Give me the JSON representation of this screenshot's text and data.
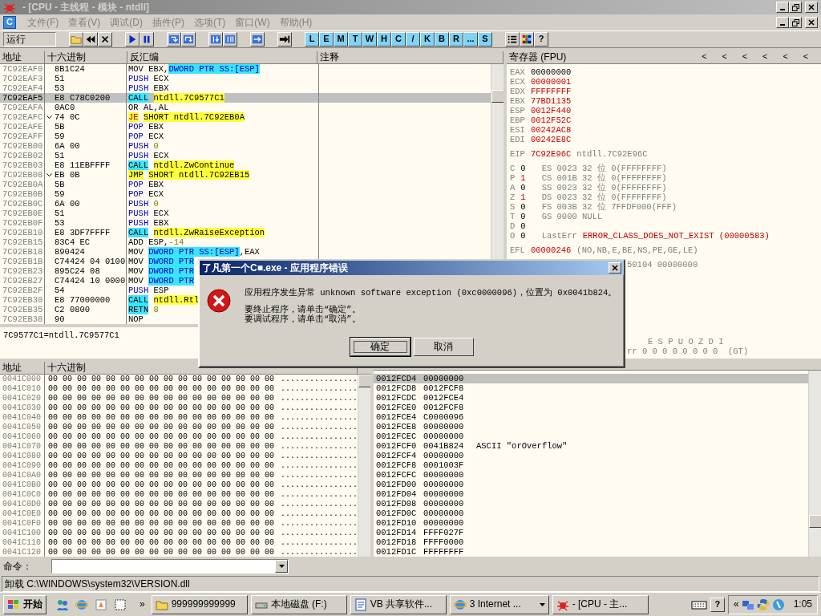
{
  "title_bar": {
    "title": "- [CPU - 主线程 - 模块 - ntdll]"
  },
  "menu_bar": {
    "app_letter": "C",
    "menus": [
      "文件(F)",
      "查看(V)",
      "调试(D)",
      "插件(P)",
      "选项(T)",
      "窗口(W)",
      "帮助(H)"
    ]
  },
  "toolbar": {
    "status": "运行",
    "groups": [
      [
        {
          "kind": "folder"
        },
        {
          "kind": "rewind"
        },
        {
          "kind": "close"
        }
      ],
      [
        {
          "kind": "play"
        },
        {
          "kind": "pause"
        }
      ],
      [
        {
          "kind": "stepin"
        },
        {
          "kind": "stepover"
        }
      ],
      [
        {
          "kind": "tracein"
        },
        {
          "kind": "traceover"
        }
      ],
      [
        {
          "kind": "return"
        }
      ],
      [
        {
          "kind": "goto"
        }
      ],
      [
        {
          "kind": "letter",
          "label": "L"
        },
        {
          "kind": "letter",
          "label": "E"
        },
        {
          "kind": "letter",
          "label": "M"
        },
        {
          "kind": "letter",
          "label": "T"
        },
        {
          "kind": "letter",
          "label": "W"
        },
        {
          "kind": "letter",
          "label": "H"
        },
        {
          "kind": "letter",
          "label": "C"
        },
        {
          "kind": "letter",
          "label": "/"
        },
        {
          "kind": "letter",
          "label": "K"
        },
        {
          "kind": "letter",
          "label": "B"
        },
        {
          "kind": "letter",
          "label": "R"
        },
        {
          "kind": "letter",
          "label": "..."
        },
        {
          "kind": "letter",
          "label": "S"
        }
      ],
      [
        {
          "kind": "list"
        },
        {
          "kind": "palette"
        },
        {
          "kind": "text",
          "label": "?"
        }
      ]
    ]
  },
  "disassembly": {
    "columns": [
      "地址",
      "十六进制",
      "反汇编",
      "注释"
    ],
    "rows": [
      {
        "addr": "7C92EAF0",
        "hex": "8B1C24",
        "jump": false,
        "selected": false,
        "asm": [
          {
            "t": "MOV",
            "kind": "mn"
          },
          {
            "t": "EBX,",
            "kind": "op"
          },
          {
            "t": "DWORD PTR SS:[ESP]",
            "kind": "mem"
          }
        ]
      },
      {
        "addr": "7C92EAF3",
        "hex": "51",
        "jump": false,
        "selected": false,
        "asm": [
          {
            "t": "PUSH",
            "kind": "stk"
          },
          {
            "t": "ECX",
            "kind": "op"
          }
        ]
      },
      {
        "addr": "7C92EAF4",
        "hex": "53",
        "jump": false,
        "selected": false,
        "asm": [
          {
            "t": "PUSH",
            "kind": "stk"
          },
          {
            "t": "EBX",
            "kind": "op"
          }
        ]
      },
      {
        "addr": "7C92EAF5",
        "hex": "E8 C78C0200",
        "jump": false,
        "selected": true,
        "asm": [
          {
            "t": "CALL",
            "kind": "call"
          },
          {
            "t": "ntdll.7C9577C1",
            "kind": "tgt"
          }
        ]
      },
      {
        "addr": "7C92EAFA",
        "hex": "0AC0",
        "jump": false,
        "selected": false,
        "asm": [
          {
            "t": "OR",
            "kind": "mn"
          },
          {
            "t": "AL,AL",
            "kind": "op"
          }
        ]
      },
      {
        "addr": "7C92EAFC",
        "hex": "74 0C",
        "jump": true,
        "selected": false,
        "asm": [
          {
            "t": "JE",
            "kind": "jcc"
          },
          {
            "t": "SHORT ntdll.7C92EB0A",
            "kind": "tgt"
          }
        ]
      },
      {
        "addr": "7C92EAFE",
        "hex": "5B",
        "jump": false,
        "selected": false,
        "asm": [
          {
            "t": "POP",
            "kind": "stk"
          },
          {
            "t": "EBX",
            "kind": "op"
          }
        ]
      },
      {
        "addr": "7C92EAFF",
        "hex": "59",
        "jump": false,
        "selected": false,
        "asm": [
          {
            "t": "POP",
            "kind": "stk"
          },
          {
            "t": "ECX",
            "kind": "op"
          }
        ]
      },
      {
        "addr": "7C92EB00",
        "hex": "6A 00",
        "jump": false,
        "selected": false,
        "asm": [
          {
            "t": "PUSH",
            "kind": "stk"
          },
          {
            "t": "0",
            "kind": "imm"
          }
        ]
      },
      {
        "addr": "7C92EB02",
        "hex": "51",
        "jump": false,
        "selected": false,
        "asm": [
          {
            "t": "PUSH",
            "kind": "stk"
          },
          {
            "t": "ECX",
            "kind": "op"
          }
        ]
      },
      {
        "addr": "7C92EB03",
        "hex": "E8 11EBFFFF",
        "jump": false,
        "selected": false,
        "asm": [
          {
            "t": "CALL",
            "kind": "call"
          },
          {
            "t": "ntdll.ZwContinue",
            "kind": "tgt"
          }
        ]
      },
      {
        "addr": "7C92EB08",
        "hex": "EB 0B",
        "jump": true,
        "selected": false,
        "asm": [
          {
            "t": "JMP",
            "kind": "jmp"
          },
          {
            "t": "SHORT ntdll.7C92EB15",
            "kind": "tgt"
          }
        ]
      },
      {
        "addr": "7C92EB0A",
        "hex": "5B",
        "jump": false,
        "selected": false,
        "asm": [
          {
            "t": "POP",
            "kind": "stk"
          },
          {
            "t": "EBX",
            "kind": "op"
          }
        ]
      },
      {
        "addr": "7C92EB0B",
        "hex": "59",
        "jump": false,
        "selected": false,
        "asm": [
          {
            "t": "POP",
            "kind": "stk"
          },
          {
            "t": "ECX",
            "kind": "op"
          }
        ]
      },
      {
        "addr": "7C92EB0C",
        "hex": "6A 00",
        "jump": false,
        "selected": false,
        "asm": [
          {
            "t": "PUSH",
            "kind": "stk"
          },
          {
            "t": "0",
            "kind": "imm"
          }
        ]
      },
      {
        "addr": "7C92EB0E",
        "hex": "51",
        "jump": false,
        "selected": false,
        "asm": [
          {
            "t": "PUSH",
            "kind": "stk"
          },
          {
            "t": "ECX",
            "kind": "op"
          }
        ]
      },
      {
        "addr": "7C92EB0F",
        "hex": "53",
        "jump": false,
        "selected": false,
        "asm": [
          {
            "t": "PUSH",
            "kind": "stk"
          },
          {
            "t": "EBX",
            "kind": "op"
          }
        ]
      },
      {
        "addr": "7C92EB10",
        "hex": "E8 3DF7FFFF",
        "jump": false,
        "selected": false,
        "asm": [
          {
            "t": "CALL",
            "kind": "call"
          },
          {
            "t": "ntdll.ZwRaiseException",
            "kind": "tgt"
          }
        ]
      },
      {
        "addr": "7C92EB15",
        "hex": "83C4 EC",
        "jump": false,
        "selected": false,
        "asm": [
          {
            "t": "ADD",
            "kind": "mn"
          },
          {
            "t": "ESP,",
            "kind": "op"
          },
          {
            "t": "-14",
            "kind": "imm"
          }
        ]
      },
      {
        "addr": "7C92EB18",
        "hex": "890424",
        "jump": false,
        "selected": false,
        "asm": [
          {
            "t": "MOV",
            "kind": "mn"
          },
          {
            "t": "DWORD PTR SS:[ESP]",
            "kind": "mem"
          },
          {
            "t": ",EAX",
            "kind": "op"
          }
        ]
      },
      {
        "addr": "7C92EB1B",
        "hex": "C74424 04 0100",
        "jump": false,
        "selected": false,
        "asm": [
          {
            "t": "MOV",
            "kind": "mn"
          },
          {
            "t": "DWORD PTR",
            "kind": "mem"
          }
        ]
      },
      {
        "addr": "7C92EB23",
        "hex": "895C24 08",
        "jump": false,
        "selected": false,
        "asm": [
          {
            "t": "MOV",
            "kind": "mn"
          },
          {
            "t": "DWORD PTR",
            "kind": "mem"
          }
        ]
      },
      {
        "addr": "7C92EB27",
        "hex": "C74424 10 0000",
        "jump": false,
        "selected": false,
        "asm": [
          {
            "t": "MOV",
            "kind": "mn"
          },
          {
            "t": "DWORD PTR",
            "kind": "mem"
          }
        ]
      },
      {
        "addr": "7C92EB2F",
        "hex": "54",
        "jump": false,
        "selected": false,
        "asm": [
          {
            "t": "PUSH",
            "kind": "stk"
          },
          {
            "t": "ESP",
            "kind": "op"
          }
        ]
      },
      {
        "addr": "7C92EB30",
        "hex": "E8 77000000",
        "jump": false,
        "selected": false,
        "asm": [
          {
            "t": "CALL",
            "kind": "call"
          },
          {
            "t": "ntdll.Rtl",
            "kind": "tgt"
          }
        ]
      },
      {
        "addr": "7C92EB35",
        "hex": "C2 0800",
        "jump": false,
        "selected": false,
        "asm": [
          {
            "t": "RETN",
            "kind": "call"
          },
          {
            "t": "8",
            "kind": "imm"
          }
        ]
      },
      {
        "addr": "7C92EB38",
        "hex": "90",
        "jump": false,
        "selected": false,
        "asm": [
          {
            "t": "NOP",
            "kind": "mn"
          }
        ]
      }
    ],
    "info": "7C9577C1=ntdll.7C9577C1"
  },
  "registers": {
    "title": "寄存器 (FPU)",
    "arrows": [
      "<",
      "<",
      "<",
      "<",
      "<",
      "<"
    ],
    "groups": [
      [
        {
          "kind": "reg",
          "name": "EAX",
          "value": "00000000",
          "changed": false
        },
        {
          "kind": "reg",
          "name": "ECX",
          "value": "00000001",
          "changed": true
        },
        {
          "kind": "reg",
          "name": "EDX",
          "value": "FFFFFFFF",
          "changed": true
        },
        {
          "kind": "reg",
          "name": "EBX",
          "value": "77BD1135",
          "changed": true
        },
        {
          "kind": "reg",
          "name": "ESP",
          "value": "0012F440",
          "changed": true
        },
        {
          "kind": "reg",
          "name": "EBP",
          "value": "0012F52C",
          "changed": true
        },
        {
          "kind": "reg",
          "name": "ESI",
          "value": "00242AC8",
          "changed": true
        },
        {
          "kind": "reg",
          "name": "EDI",
          "value": "00242E8C",
          "changed": true
        }
      ],
      [
        {
          "kind": "reg",
          "name": "EIP",
          "value": "7C92E96C",
          "changed": true,
          "comment": "ntdll.7C92E96C"
        }
      ],
      [
        {
          "kind": "flag",
          "name": "C",
          "value": "0",
          "changed": false,
          "detail": "ES 0023 32 位 0(FFFFFFFF)"
        },
        {
          "kind": "flag",
          "name": "P",
          "value": "1",
          "changed": true,
          "detail": "CS 001B 32 位 0(FFFFFFFF)"
        },
        {
          "kind": "flag",
          "name": "A",
          "value": "0",
          "changed": false,
          "detail": "SS 0023 32 位 0(FFFFFFFF)"
        },
        {
          "kind": "flag",
          "name": "Z",
          "value": "1",
          "changed": true,
          "detail": "DS 0023 32 位 0(FFFFFFFF)"
        },
        {
          "kind": "flag",
          "name": "S",
          "value": "0",
          "changed": false,
          "detail": "FS 003B 32 位 7FFDF000(FFF)"
        },
        {
          "kind": "flag",
          "name": "T",
          "value": "0",
          "changed": false,
          "detail": "GS 0000 NULL"
        },
        {
          "kind": "flag",
          "name": "D",
          "value": "0",
          "changed": false
        },
        {
          "kind": "flag",
          "name": "O",
          "value": "0",
          "changed": false,
          "label": "LastErr",
          "error": "ERROR_CLASS_DOES_NOT_EXIST (00000583)"
        }
      ],
      [
        {
          "kind": "reg",
          "name": "EFL",
          "value": "00000246",
          "changed": true,
          "comment": "(NO,NB,E,BE,NS,PE,GE,LE)"
        }
      ],
      [
        {
          "kind": "partial",
          "text": "50104 00000000"
        }
      ],
      [
        {
          "kind": "fpuhead",
          "text": "E S P U O Z D I"
        },
        {
          "kind": "partial",
          "text": "rr 0 0 0 0 0 0 0 0  (GT)"
        }
      ]
    ]
  },
  "dump": {
    "columns": [
      "地址",
      "十六进制"
    ],
    "rows": [
      {
        "addr": "0041C000",
        "hex": "00 00 00 00 00 00 00 00 00 00 00 00 00 00 00 00",
        "ascii": "................"
      },
      {
        "addr": "0041C010",
        "hex": "00 00 00 00 00 00 00 00 00 00 00 00 00 00 00 00",
        "ascii": "................"
      },
      {
        "addr": "0041C020",
        "hex": "00 00 00 00 00 00 00 00 00 00 00 00 00 00 00 00",
        "ascii": "................"
      },
      {
        "addr": "0041C030",
        "hex": "00 00 00 00 00 00 00 00 00 00 00 00 00 00 00 00",
        "ascii": "................"
      },
      {
        "addr": "0041C040",
        "hex": "00 00 00 00 00 00 00 00 00 00 00 00 00 00 00 00",
        "ascii": "................"
      },
      {
        "addr": "0041C050",
        "hex": "00 00 00 00 00 00 00 00 00 00 00 00 00 00 00 00",
        "ascii": "................"
      },
      {
        "addr": "0041C060",
        "hex": "00 00 00 00 00 00 00 00 00 00 00 00 00 00 00 00",
        "ascii": "................"
      },
      {
        "addr": "0041C070",
        "hex": "00 00 00 00 00 00 00 00 00 00 00 00 00 00 00 00",
        "ascii": "................"
      },
      {
        "addr": "0041C080",
        "hex": "00 00 00 00 00 00 00 00 00 00 00 00 00 00 00 00",
        "ascii": "................"
      },
      {
        "addr": "0041C090",
        "hex": "00 00 00 00 00 00 00 00 00 00 00 00 00 00 00 00",
        "ascii": "................"
      },
      {
        "addr": "0041C0A0",
        "hex": "00 00 00 00 00 00 00 00 00 00 00 00 00 00 00 00",
        "ascii": "................"
      },
      {
        "addr": "0041C0B0",
        "hex": "00 00 00 00 00 00 00 00 00 00 00 00 00 00 00 00",
        "ascii": "................"
      },
      {
        "addr": "0041C0C0",
        "hex": "00 00 00 00 00 00 00 00 00 00 00 00 00 00 00 00",
        "ascii": "................"
      },
      {
        "addr": "0041C0D0",
        "hex": "00 00 00 00 00 00 00 00 00 00 00 00 00 00 00 00",
        "ascii": "................"
      },
      {
        "addr": "0041C0E0",
        "hex": "00 00 00 00 00 00 00 00 00 00 00 00 00 00 00 00",
        "ascii": "................"
      },
      {
        "addr": "0041C0F0",
        "hex": "00 00 00 00 00 00 00 00 00 00 00 00 00 00 00 00",
        "ascii": "................"
      },
      {
        "addr": "0041C100",
        "hex": "00 00 00 00 00 00 00 00 00 00 00 00 00 00 00 00",
        "ascii": "................"
      },
      {
        "addr": "0041C110",
        "hex": "00 00 00 00 00 00 00 00 00 00 00 00 00 00 00 00",
        "ascii": "................"
      },
      {
        "addr": "0041C120",
        "hex": "00 00 00 00 00 00 00 00 00 00 00 00 00 00 00 00",
        "ascii": "................"
      }
    ]
  },
  "stack": {
    "rows": [
      {
        "addr": "0012FCD4",
        "value": "00000000",
        "selected": true
      },
      {
        "addr": "0012FCD8",
        "value": "0012FCF8",
        "selected": false
      },
      {
        "addr": "0012FCDC",
        "value": "0012FCE4",
        "selected": false
      },
      {
        "addr": "0012FCE0",
        "value": "0012FCF8",
        "selected": false
      },
      {
        "addr": "0012FCE4",
        "value": "C0000096",
        "selected": false
      },
      {
        "addr": "0012FCE8",
        "value": "00000000",
        "selected": false
      },
      {
        "addr": "0012FCEC",
        "value": "00000000",
        "selected": false
      },
      {
        "addr": "0012FCF0",
        "value": "0041B824",
        "selected": false,
        "comment": "ASCII \"orOverflow\""
      },
      {
        "addr": "0012FCF4",
        "value": "00000000",
        "selected": false
      },
      {
        "addr": "0012FCF8",
        "value": "0001003F",
        "selected": false
      },
      {
        "addr": "0012FCFC",
        "value": "00000000",
        "selected": false
      },
      {
        "addr": "0012FD00",
        "value": "00000000",
        "selected": false
      },
      {
        "addr": "0012FD04",
        "value": "00000000",
        "selected": false
      },
      {
        "addr": "0012FD08",
        "value": "00000000",
        "selected": false
      },
      {
        "addr": "0012FD0C",
        "value": "00000000",
        "selected": false
      },
      {
        "addr": "0012FD10",
        "value": "00000000",
        "selected": false
      },
      {
        "addr": "0012FD14",
        "value": "FFFF027F",
        "selected": false
      },
      {
        "addr": "0012FD18",
        "value": "FFFF0000",
        "selected": false
      },
      {
        "addr": "0012FD1C",
        "value": "FFFFFFFF",
        "selected": false
      }
    ]
  },
  "command_bar": {
    "label": "命令："
  },
  "status_bar": {
    "text": "卸载 C:\\WINDOWS\\system32\\VERSION.dll"
  },
  "dialog": {
    "title": "了凡第一个C■.exe - 应用程序错误",
    "message": "应用程序发生异常 unknown software exception (0xc0000096)，位置为 0x0041b824。",
    "hints": [
      "要终止程序，请单击“确定”。",
      "要调试程序，请单击“取消”。"
    ],
    "buttons": [
      {
        "label": "确定",
        "focused": true
      },
      {
        "label": "取消",
        "focused": false
      }
    ]
  },
  "taskbar": {
    "start": "开始",
    "quick_launch": [
      {
        "kind": "people"
      },
      {
        "kind": "browser"
      },
      {
        "kind": "paint"
      },
      {
        "kind": "blank"
      }
    ],
    "more": "»",
    "tasks": [
      {
        "kind": "folder",
        "label": "999999999999",
        "menu": false
      },
      {
        "kind": "drive",
        "label": "本地磁盘 (F:)",
        "menu": false
      },
      {
        "kind": "document",
        "label": "VB 共享软件...",
        "menu": false
      },
      {
        "kind": "browser",
        "label": "3 Internet ...",
        "menu": true
      },
      {
        "kind": "bug",
        "label": "- [CPU - 主...",
        "menu": false
      }
    ],
    "help_label": "?",
    "tray_expand": "«",
    "clock": "1:05"
  }
}
